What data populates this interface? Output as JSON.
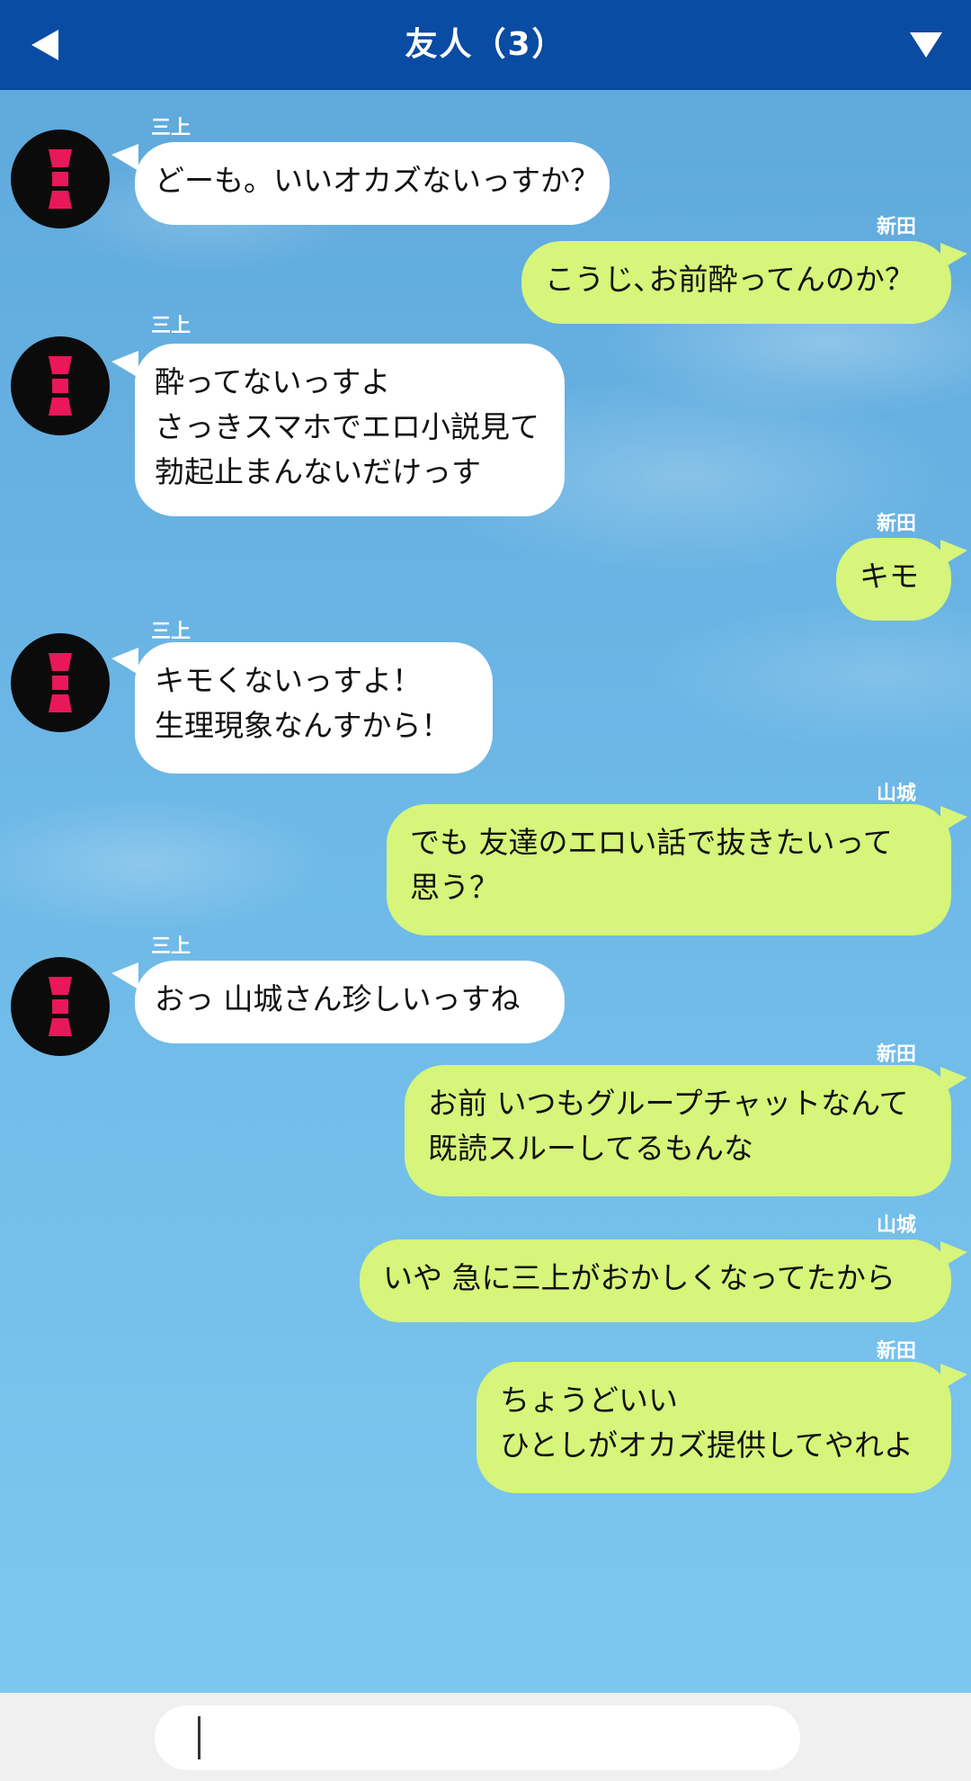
{
  "header": {
    "title": "友人（3）",
    "back_icon": "back-triangle-icon",
    "menu_icon": "dropdown-triangle-icon",
    "bar_color": "#0a4ba3"
  },
  "colors": {
    "outgoing_bubble": "#d6f57a",
    "incoming_bubble": "#ffffff",
    "sky_top": "#5fa9dc",
    "sky_bottom": "#7dc7ef"
  },
  "messages": [
    {
      "sender": "三上",
      "side": "left",
      "text": "どーも。いいオカズないっすか？"
    },
    {
      "sender": "新田",
      "side": "right",
      "text": "こうじ､お前酔ってんのか？"
    },
    {
      "sender": "三上",
      "side": "left",
      "text": "酔ってないっすよ\nさっきスマホでエロ小説見て\n勃起止まんないだけっす"
    },
    {
      "sender": "新田",
      "side": "right",
      "text": "キモ"
    },
    {
      "sender": "三上",
      "side": "left",
      "text": "キモくないっすよ！\n生理現象なんすから！"
    },
    {
      "sender": "山城",
      "side": "right",
      "text": "でも 友達のエロい話で抜きたいって\n思う？"
    },
    {
      "sender": "三上",
      "side": "left",
      "text": "おっ 山城さん珍しいっすね"
    },
    {
      "sender": "新田",
      "side": "right",
      "text": "お前 いつもグループチャットなんて\n既読スルーしてるもんな"
    },
    {
      "sender": "山城",
      "side": "right",
      "text": "いや 急に三上がおかしくなってたから"
    },
    {
      "sender": "新田",
      "side": "right",
      "text": "ちょうどいい\nひとしがオカズ提供してやれよ"
    }
  ],
  "input": {
    "value": "",
    "placeholder": ""
  }
}
